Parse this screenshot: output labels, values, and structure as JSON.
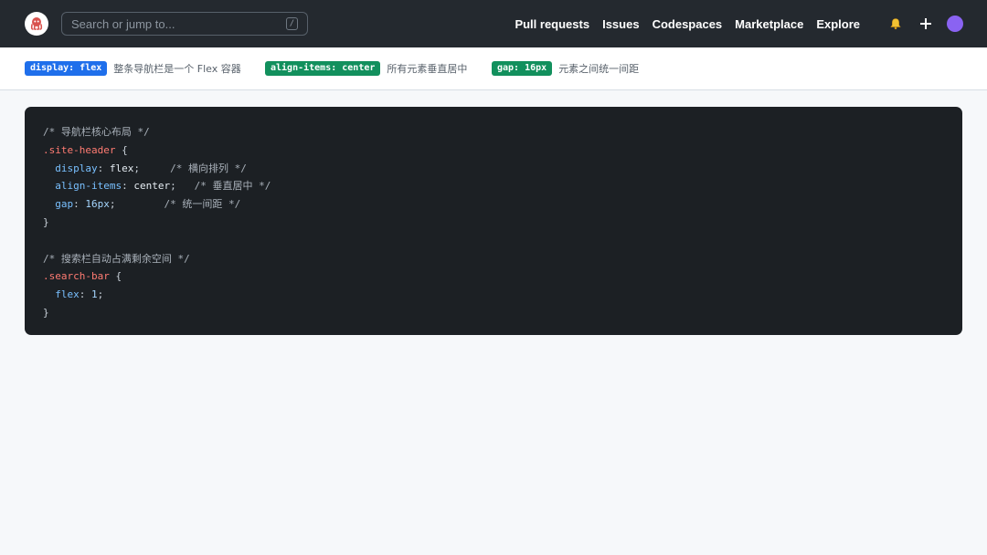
{
  "header": {
    "search": {
      "placeholder": "Search or jump to...",
      "shortcut_key": "/"
    },
    "nav": [
      "Pull requests",
      "Issues",
      "Codespaces",
      "Marketplace",
      "Explore"
    ],
    "icons": {
      "logo": "octopus-logo-icon",
      "notifications": "bell-icon",
      "create": "plus-icon",
      "profile": "avatar-icon"
    },
    "colors": {
      "background": "#24292f",
      "avatar": "#8a63f2"
    }
  },
  "legend": [
    {
      "tag": "display: flex",
      "color": "#1f6feb",
      "description": "整条导航栏是一个 Flex 容器"
    },
    {
      "tag": "align-items: center",
      "color": "#12905d",
      "description": "所有元素垂直居中"
    },
    {
      "tag": "gap: 16px",
      "color": "#12905d",
      "description": "元素之间统一间距"
    }
  ],
  "code": {
    "comment1": "/* 导航栏核心布局 */",
    "selector1": ".site-header",
    "open_brace": "{",
    "close_brace": "}",
    "decl1": {
      "prop": "display",
      "value": "flex",
      "comment": "/* 横向排列 */"
    },
    "decl2": {
      "prop": "align-items",
      "value": "center",
      "comment": "/* 垂直居中 */"
    },
    "decl3": {
      "prop": "gap",
      "value": "16px",
      "comment": "/* 统一间距 */"
    },
    "comment2": "/* 搜索栏自动占满剩余空间 */",
    "selector2": ".search-bar",
    "decl4": {
      "prop": "flex",
      "value": "1"
    }
  }
}
